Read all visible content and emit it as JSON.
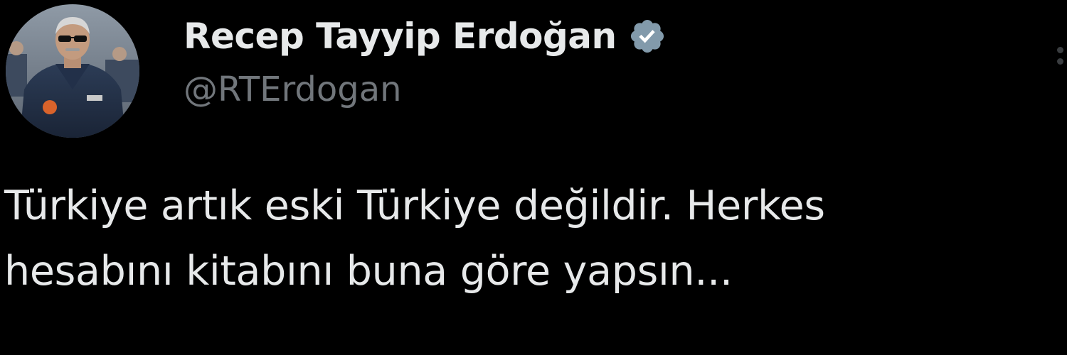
{
  "tweet": {
    "author": {
      "display_name": "Recep Tayyip Erdoğan",
      "handle": "@RTErdogan",
      "verified": true,
      "verified_icon": "verified-badge-icon",
      "avatar": "profile-photo"
    },
    "text_lines": [
      "Türkiye artık eski Türkiye değildir. Herkes",
      "hesabını kitabını buna göre yapsın..."
    ],
    "more_icon": "more-options-icon"
  },
  "colors": {
    "background": "#000000",
    "text_primary": "#e7e9ea",
    "text_secondary": "#71767b",
    "verified_badge": "#829aab"
  }
}
